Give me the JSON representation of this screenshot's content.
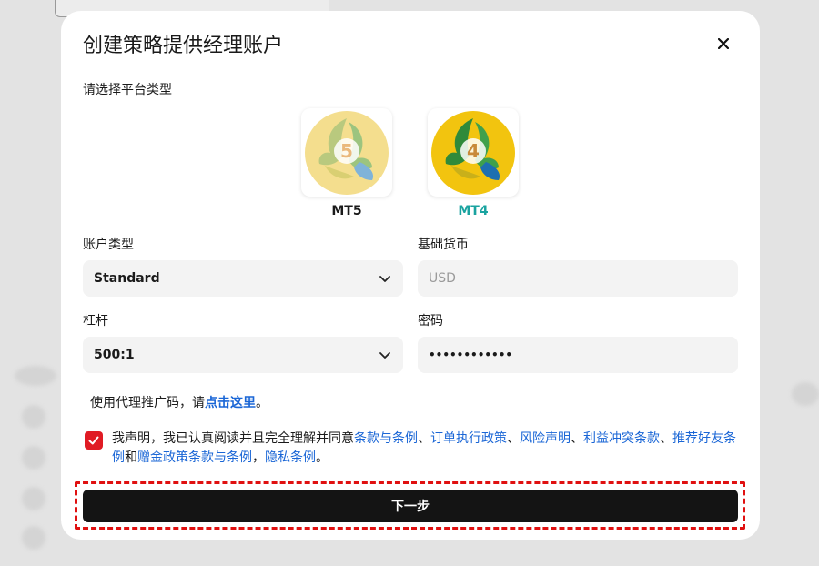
{
  "modal": {
    "title": "创建策略提供经理账户",
    "close_icon": "close-icon"
  },
  "platform": {
    "label": "请选择平台类型",
    "options": [
      {
        "name": "MT5",
        "number": "5",
        "selected": false
      },
      {
        "name": "MT4",
        "number": "4",
        "selected": true
      }
    ],
    "selected_color": "#1aa3a0"
  },
  "form": {
    "account_type": {
      "label": "账户类型",
      "value": "Standard"
    },
    "base_currency": {
      "label": "基础货币",
      "value": "USD"
    },
    "leverage": {
      "label": "杠杆",
      "value": "500:1"
    },
    "password": {
      "label": "密码",
      "value": "••••••••••••"
    }
  },
  "promo": {
    "prefix": "使用代理推广码，请",
    "link": "点击这里",
    "suffix": "。"
  },
  "declaration": {
    "checked": true,
    "prefix": "我声明，我已认真阅读并且完全理解并同意",
    "links": [
      "条款与条例",
      "订单执行政策",
      "风险声明",
      "利益冲突条款",
      "推荐好友条例",
      "赠金政策条款与条例",
      "隐私条例"
    ],
    "sep": "、",
    "and": "和",
    "comma": "，",
    "end": "。"
  },
  "next_button": {
    "label": "下一步"
  },
  "colors": {
    "accent": "#e01b24",
    "link": "#1a66d6",
    "button_bg": "#141414",
    "highlight": "#e01010"
  }
}
